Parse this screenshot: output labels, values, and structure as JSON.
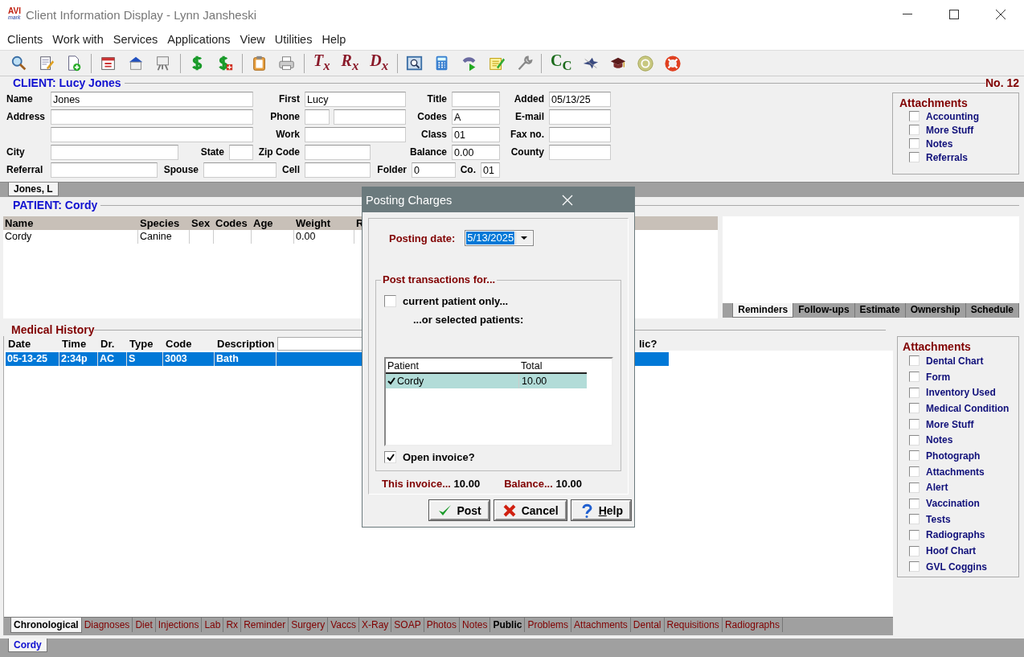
{
  "window": {
    "logo_top": "AVI",
    "logo_bottom": "mark",
    "title": "Client Information Display - Lynn Jansheski"
  },
  "menu": [
    "Clients",
    "Work with",
    "Services",
    "Applications",
    "View",
    "Utilities",
    "Help"
  ],
  "toolbar_labels": [
    "T$_{x}$",
    "R$_{x}$",
    "D$_{x}$",
    "C$_{C}$"
  ],
  "client": {
    "title": "CLIENT:  Lucy Jones",
    "number": "No. 12",
    "lines": [
      {
        "fields": [
          {
            "kind": "textbox",
            "label": "Name",
            "value": "Jones"
          },
          {
            "kind": "textbox",
            "label": "First",
            "value": "Lucy"
          },
          {
            "kind": "textbox",
            "label": "Title"
          },
          {
            "kind": "textbox",
            "label": "Added",
            "value": "05/13/25"
          }
        ]
      },
      {
        "fields": [
          {
            "kind": "textbox",
            "label": "Address"
          },
          {
            "kind": "textbox",
            "label": "Phone"
          },
          {
            "kind": "textbox"
          },
          {
            "kind": "textbox",
            "label": "Codes",
            "value": "A"
          },
          {
            "kind": "textbox",
            "label": "E-mail"
          }
        ]
      },
      {
        "fields": [
          {
            "kind": "textbox"
          },
          {
            "kind": "textbox",
            "label": "Work"
          },
          {
            "kind": "textbox",
            "label": "Class",
            "value": "01"
          },
          {
            "kind": "textbox",
            "label": "Fax no."
          }
        ]
      },
      {
        "fields": [
          {
            "kind": "textbox",
            "label": "City"
          },
          {
            "kind": "textbox",
            "label": "State"
          },
          {
            "kind": "textbox",
            "label": "Zip Code"
          },
          {
            "kind": "textbox",
            "label": "Balance",
            "value": "0.00"
          },
          {
            "kind": "textbox",
            "label": "County"
          }
        ]
      },
      {
        "fields": [
          {
            "kind": "textbox",
            "label": "Referral"
          },
          {
            "kind": "textbox",
            "label": "Spouse"
          },
          {
            "kind": "textbox",
            "label": "Cell"
          },
          {
            "kind": "textbox",
            "label": "Folder",
            "value": "0"
          },
          {
            "kind": "textbox",
            "label": "Co.",
            "value": "01"
          }
        ]
      }
    ]
  },
  "client_attachments": {
    "title": "Attachments",
    "items": [
      {
        "label": "Accounting",
        "checked": false
      },
      {
        "label": "More Stuff",
        "checked": false
      },
      {
        "label": "Notes",
        "checked": false
      },
      {
        "label": "Referrals",
        "checked": false
      }
    ]
  },
  "client_tabs": [
    {
      "label": "Jones, L",
      "selected": true
    }
  ],
  "patient": {
    "title": "PATIENT:  Cordy",
    "columns": [
      "Name",
      "Species",
      "Sex",
      "Codes",
      "Age",
      "Weight",
      "R"
    ],
    "rows": [
      {
        "name": "Cordy",
        "species": "Canine",
        "weight": "0.00"
      }
    ]
  },
  "side_tabs": [
    {
      "label": "Reminders",
      "selected": true
    },
    {
      "label": "Follow-ups",
      "selected": false
    },
    {
      "label": "Estimate",
      "selected": false
    },
    {
      "label": "Ownership",
      "selected": false
    },
    {
      "label": "Schedule",
      "selected": false
    }
  ],
  "medical_history": {
    "title": "Medical History",
    "columns": [
      "Date",
      "Time",
      "Dr.",
      "Type",
      "Code",
      "Description",
      "lic?"
    ],
    "rows": [
      {
        "selected": true,
        "date": "05-13-25",
        "time": "2:34p",
        "dr": "AC",
        "type": "S",
        "code": "3003",
        "description": "Bath"
      }
    ]
  },
  "history_tabs": [
    {
      "label": "Chronological",
      "selected": true,
      "emphasized": false
    },
    {
      "label": "Diagnoses",
      "selected": false,
      "emphasized": false
    },
    {
      "label": "Diet",
      "selected": false,
      "emphasized": false
    },
    {
      "label": "Injections",
      "selected": false,
      "emphasized": false
    },
    {
      "label": "Lab",
      "selected": false,
      "emphasized": false
    },
    {
      "label": "Rx",
      "selected": false,
      "emphasized": false
    },
    {
      "label": "Reminder",
      "selected": false,
      "emphasized": false
    },
    {
      "label": "Surgery",
      "selected": false,
      "emphasized": false
    },
    {
      "label": "Vaccs",
      "selected": false,
      "emphasized": false
    },
    {
      "label": "X-Ray",
      "selected": false,
      "emphasized": false
    },
    {
      "label": "SOAP",
      "selected": false,
      "emphasized": false
    },
    {
      "label": "Photos",
      "selected": false,
      "emphasized": false
    },
    {
      "label": "Notes",
      "selected": false,
      "emphasized": false
    },
    {
      "label": "Public",
      "selected": false,
      "emphasized": true
    },
    {
      "label": "Problems",
      "selected": false,
      "emphasized": false
    },
    {
      "label": "Attachments",
      "selected": false,
      "emphasized": false
    },
    {
      "label": "Dental",
      "selected": false,
      "emphasized": false
    },
    {
      "label": "Requisitions",
      "selected": false,
      "emphasized": false
    },
    {
      "label": "Radiographs",
      "selected": false,
      "emphasized": false
    }
  ],
  "patient_attachments": {
    "title": "Attachments",
    "items": [
      {
        "label": "Dental Chart",
        "checked": false
      },
      {
        "label": "Form",
        "checked": false
      },
      {
        "label": "Inventory Used",
        "checked": false
      },
      {
        "label": "Medical Condition",
        "checked": false
      },
      {
        "label": "More Stuff",
        "checked": false
      },
      {
        "label": "Notes",
        "checked": false
      },
      {
        "label": "Photograph",
        "checked": false
      },
      {
        "label": "Attachments",
        "checked": false
      },
      {
        "label": "Alert",
        "checked": false
      },
      {
        "label": "Vaccination",
        "checked": false
      },
      {
        "label": "Tests",
        "checked": false
      },
      {
        "label": "Radiographs",
        "checked": false
      },
      {
        "label": "Hoof Chart",
        "checked": false
      },
      {
        "label": "GVL Coggins",
        "checked": false
      }
    ]
  },
  "patient_tabs": [
    {
      "label": "Cordy",
      "selected": true
    }
  ],
  "dialog": {
    "title": "Posting Charges",
    "date_label": "Posting date:",
    "date_value": "5/13/2025",
    "group_title": "Post transactions for...",
    "current_only": {
      "label": "current patient only...",
      "checked": false
    },
    "or_selected": "...or selected patients:",
    "list_columns": [
      "Patient",
      "Total"
    ],
    "list_rows": [
      {
        "patient": "Cordy",
        "total": "10.00",
        "checked": true,
        "selected": true
      }
    ],
    "open_invoice": {
      "label": "Open invoice?",
      "checked": true
    },
    "this_invoice_label": "This invoice...",
    "this_invoice": "10.00",
    "balance_label": "Balance...",
    "balance": "10.00",
    "buttons": [
      {
        "kind": "post",
        "label": "Post"
      },
      {
        "kind": "cancel",
        "label": "Cancel"
      },
      {
        "kind": "help",
        "label": "Help"
      }
    ]
  }
}
